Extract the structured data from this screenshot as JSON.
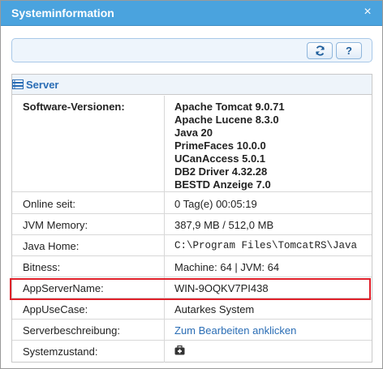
{
  "window": {
    "title": "Systeminformation",
    "close_glyph": "×"
  },
  "toolbar": {
    "refresh_icon": "refresh-icon",
    "help_label": "?"
  },
  "panel": {
    "title": "Server",
    "icon": "server-icon"
  },
  "software": {
    "label": "Software-Versionen:",
    "versions": [
      "Apache Tomcat 9.0.71",
      "Apache Lucene 8.3.0",
      "Java 20",
      "PrimeFaces 10.0.0",
      "UCanAccess 5.0.1",
      "DB2 Driver 4.32.28",
      "BESTD Anzeige 7.0"
    ]
  },
  "rows": [
    {
      "label": "Online seit:",
      "value": "0 Tag(e) 00:05:19"
    },
    {
      "label": "JVM Memory:",
      "value": "387,9 MB / 512,0 MB"
    },
    {
      "label": "Java Home:",
      "value": "C:\\Program Files\\TomcatRS\\Java"
    },
    {
      "label": "Bitness:",
      "value": "Machine: 64 | JVM: 64"
    },
    {
      "label": "AppServerName:",
      "value": "WIN-9OQKV7PI438"
    },
    {
      "label": "AppUseCase:",
      "value": "Autarkes System"
    },
    {
      "label": "Serverbeschreibung:",
      "value": "Zum Bearbeiten anklicken"
    },
    {
      "label": "Systemzustand:",
      "value_icon": "medkit-icon"
    }
  ],
  "colors": {
    "titlebar": "#4aa3de",
    "accent": "#2a6db5",
    "highlight": "#e0202a"
  }
}
